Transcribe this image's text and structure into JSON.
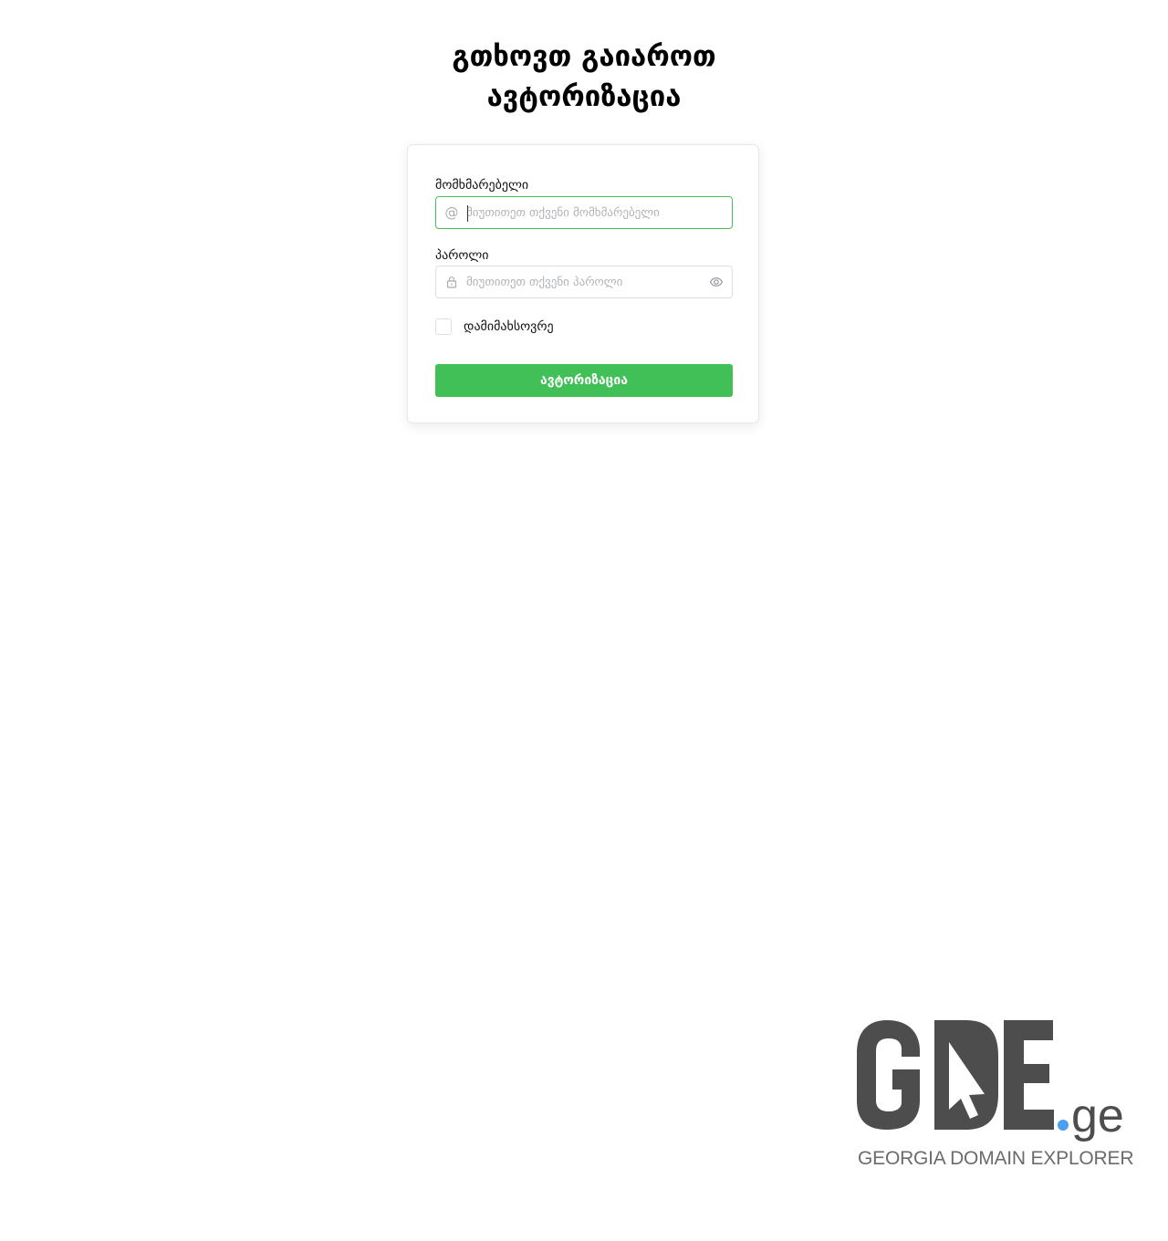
{
  "page": {
    "title_line1": "გთხოვთ გაიაროთ",
    "title_line2": "ავტორიზაცია"
  },
  "login_form": {
    "username_label": "მომხმარებელი",
    "username_placeholder": "მიუთითეთ თქვენი მომხმარებელი",
    "username_value": "",
    "password_label": "პაროლი",
    "password_placeholder": "მიუთითეთ თქვენი პაროლი",
    "password_value": "",
    "remember_label": "დამიმახსოვრე",
    "remember_checked": false,
    "submit_label": "ავტორიზაცია"
  },
  "icons": {
    "username_prefix": "at-icon",
    "password_prefix": "lock-icon",
    "password_toggle": "eye-icon"
  },
  "logo": {
    "brand": "GDE",
    "tld": "ge",
    "tagline": "GEORGIA DOMAIN EXPLORER"
  },
  "colors": {
    "accent_green": "#40c057",
    "logo_gray": "#4d4d4d",
    "logo_dot_blue": "#4a9ff0",
    "tagline_gray": "#6b6b6b"
  }
}
